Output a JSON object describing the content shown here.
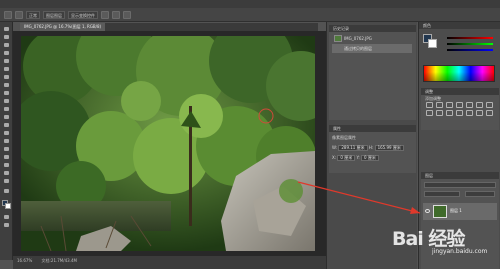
{
  "menubar": {
    "items": []
  },
  "options_bar": {
    "mode_label": "正常",
    "opacity_label": "图层图层",
    "sample_label": "显示变换控件"
  },
  "document": {
    "tab_title": "IMG_0762.JPG @ 16.7%(图层 1, RGB/8)"
  },
  "status": {
    "zoom": "16.67%",
    "doc_info": "文档:21.7M/43.4M"
  },
  "history_panel": {
    "title": "历史记录",
    "items": [
      {
        "label": "IMG_0762.JPG"
      },
      {
        "label": "通过拷贝的图层"
      }
    ]
  },
  "properties_panel": {
    "title": "属性",
    "subtitle": "像素图层属性",
    "w_label": "W:",
    "w_value": "289.11 厘米",
    "h_label": "H:",
    "h_value": "165.99 厘米",
    "x_label": "X:",
    "x_value": "0 厘米",
    "y_label": "Y:",
    "y_value": "0 厘米"
  },
  "color_panel": {
    "title": "颜色",
    "foreground": "#22374f",
    "background": "#ffffff"
  },
  "adjustments_panel": {
    "title": "调整",
    "subtitle": "添加调整"
  },
  "layers_panel": {
    "title": "图层",
    "layers": [
      {
        "name": "图层 1"
      }
    ]
  },
  "watermark": {
    "brand": "Bai  经验",
    "url": "jingyan.baidu.com"
  }
}
